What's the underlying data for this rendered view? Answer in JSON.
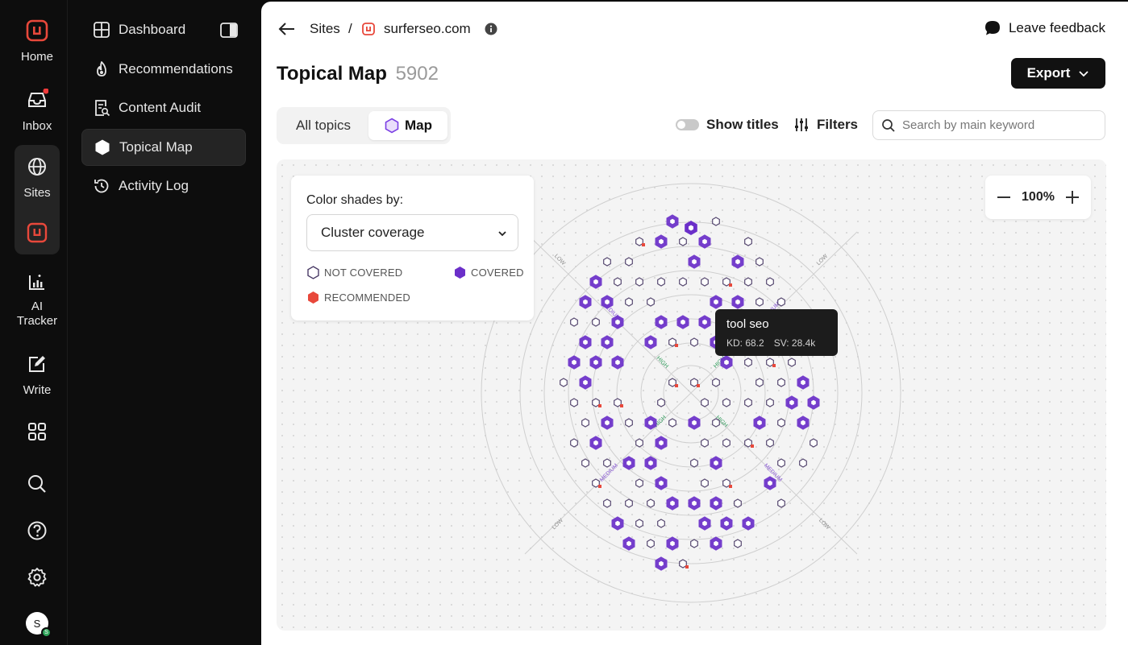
{
  "rail": {
    "items": [
      {
        "label": "Home",
        "icon": "home-logo-icon"
      },
      {
        "label": "Inbox",
        "icon": "inbox-icon"
      },
      {
        "label": "Sites",
        "icon": "globe-icon"
      },
      {
        "label": "",
        "icon": "site-logo-icon"
      },
      {
        "label": "AI Tracker",
        "icon": "ai-tracker-icon"
      },
      {
        "label": "Write",
        "icon": "write-icon"
      },
      {
        "label": "",
        "icon": "apps-grid-icon"
      },
      {
        "label": "",
        "icon": "search-icon"
      },
      {
        "label": "",
        "icon": "help-icon"
      },
      {
        "label": "",
        "icon": "settings-icon"
      }
    ],
    "avatar_initial": "S",
    "brand_color": "#e8483b"
  },
  "sidebar": {
    "items": [
      {
        "label": "Dashboard",
        "icon": "dashboard-icon"
      },
      {
        "label": "Recommendations",
        "icon": "flame-icon"
      },
      {
        "label": "Content Audit",
        "icon": "content-audit-icon"
      },
      {
        "label": "Topical Map",
        "icon": "hexagon-icon",
        "active": true
      },
      {
        "label": "Activity Log",
        "icon": "history-icon"
      }
    ]
  },
  "header": {
    "breadcrumb_root": "Sites",
    "separator": "/",
    "site": "surferseo.com",
    "feedback": "Leave feedback"
  },
  "page": {
    "title": "Topical Map",
    "count": "5902",
    "export_label": "Export"
  },
  "tabs": [
    {
      "label": "All topics",
      "active": false
    },
    {
      "label": "Map",
      "active": true
    }
  ],
  "toolbar": {
    "show_titles": "Show titles",
    "filters": "Filters",
    "search_placeholder": "Search by main keyword"
  },
  "legend": {
    "title": "Color shades by:",
    "selected": "Cluster coverage",
    "not_covered": "NOT COVERED",
    "covered": "COVERED",
    "recommended": "RECOMMENDED"
  },
  "zoom": {
    "value": "100%"
  },
  "tooltip": {
    "title": "tool seo",
    "kd": "KD: 68.2",
    "sv": "SV: 28.4k"
  },
  "map": {
    "ring_labels": [
      "HIGH",
      "MEDIUM",
      "LOW"
    ],
    "colors": {
      "covered": "#6b2fc9",
      "recommended": "#e8483b",
      "not_covered": "#4a3b66",
      "ring": "#cfcfcf",
      "high": "#2f9a5a",
      "medium": "#8a5ad6",
      "low": "#8a8a8a"
    }
  }
}
